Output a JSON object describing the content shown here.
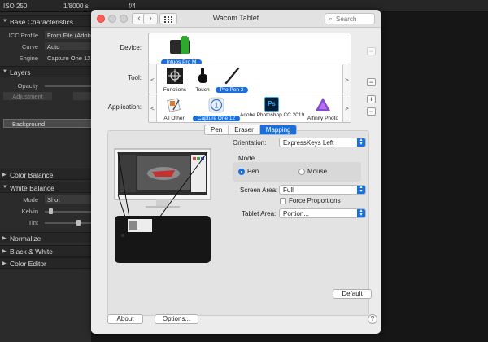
{
  "background_app": {
    "topbar": {
      "iso": "ISO 250",
      "shutter": "1/8000 s",
      "aperture": "f/4"
    },
    "sections": {
      "base_characteristics": "Base Characteristics",
      "layers": "Layers",
      "color_balance": "Color Balance",
      "white_balance": "White Balance",
      "normalize": "Normalize",
      "black_white": "Black & White",
      "color_editor": "Color Editor"
    },
    "base": {
      "icc_label": "ICC Profile",
      "icc_value": "From File (Adob",
      "curve_label": "Curve",
      "curve_value": "Auto",
      "engine_label": "Engine",
      "engine_value": "Capture One 12"
    },
    "layers": {
      "opacity_label": "Opacity",
      "adjustment": "Adjustment",
      "background_layer": "Background"
    },
    "white_balance": {
      "mode_label": "Mode",
      "mode_value": "Shot",
      "kelvin_label": "Kelvin",
      "tint_label": "Tint"
    }
  },
  "window": {
    "title": "Wacom Tablet",
    "search_placeholder": "Search"
  },
  "device_row": {
    "label": "Device:",
    "items": [
      {
        "name": "Intuos Pro M",
        "selected": true
      }
    ]
  },
  "tool_row": {
    "label": "Tool:",
    "items": [
      {
        "name": "Functions"
      },
      {
        "name": "Touch"
      },
      {
        "name": "Pro Pen 2",
        "selected": true
      }
    ]
  },
  "application_row": {
    "label": "Application:",
    "items": [
      {
        "name": "All Other"
      },
      {
        "name": "Capture One 12",
        "selected": true
      },
      {
        "name": "Adobe Photoshop CC 2019",
        "icon_text": "Ps"
      },
      {
        "name": "Affinity Photo"
      }
    ],
    "scroll_left": "<",
    "scroll_right": ">"
  },
  "controls": {
    "add": "+",
    "remove": "−"
  },
  "tabs": [
    {
      "label": "Pen"
    },
    {
      "label": "Eraser"
    },
    {
      "label": "Mapping",
      "active": true
    }
  ],
  "mapping": {
    "orientation_label": "Orientation:",
    "orientation_value": "ExpressKeys Left",
    "mode_label": "Mode",
    "mode_pen": "Pen",
    "mode_mouse": "Mouse",
    "screen_area_label": "Screen Area:",
    "screen_area_value": "Full",
    "force_proportions": "Force Proportions",
    "tablet_area_label": "Tablet Area:",
    "tablet_area_value": "Portion...",
    "default_button": "Default"
  },
  "footer": {
    "about": "About",
    "options": "Options...",
    "help": "?"
  },
  "colors": {
    "accent": "#1a6fe0",
    "close": "#fc5f57",
    "minimize": "#cfcfcf",
    "zoom": "#cfcfcf"
  }
}
